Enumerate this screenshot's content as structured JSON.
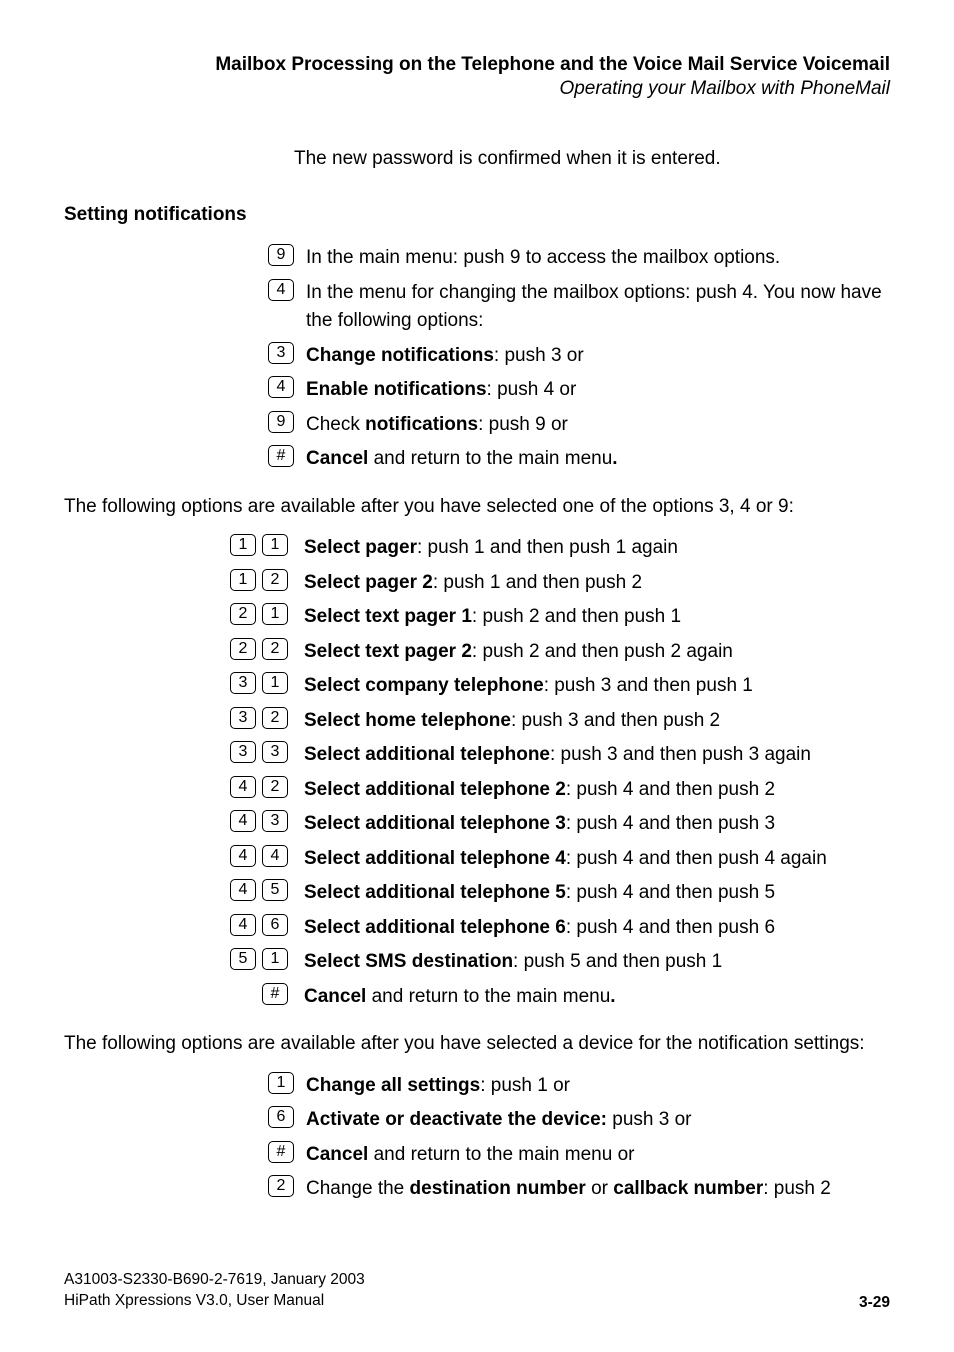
{
  "header": {
    "bold": "Mailbox Processing on the Telephone and the Voice Mail Service Voicemail",
    "italic": "Operating your Mailbox with PhoneMail"
  },
  "intro": "The new password is confirmed when it is entered.",
  "section1": {
    "title": "Setting notifications",
    "rows": [
      {
        "key": "9",
        "text": "In the main menu: push 9 to access the mailbox options."
      },
      {
        "key": "4",
        "text": "In the menu for changing the mailbox options: push 4. You now have the following options:"
      },
      {
        "key": "3",
        "bold": "Change notifications",
        "rest": ": push 3 or"
      },
      {
        "key": "4",
        "bold": "Enable notifications",
        "rest": ": push 4 or"
      },
      {
        "key": "9",
        "pre": "Check ",
        "bold": "notifications",
        "rest": ": push 9 or"
      },
      {
        "key": "#",
        "bold": "Cancel",
        "rest": " and return to the main menu",
        "boldPeriod": "."
      }
    ]
  },
  "para1": "The following options are available after you have selected one of the options 3, 4 or 9:",
  "section2": {
    "rows": [
      {
        "k1": "1",
        "k2": "1",
        "bold": "Select pager",
        "rest": ": push 1 and then push 1 again"
      },
      {
        "k1": "1",
        "k2": "2",
        "bold": "Select pager 2",
        "rest": ": push 1 and then push 2"
      },
      {
        "k1": "2",
        "k2": "1",
        "bold": "Select text pager 1",
        "rest": ": push 2 and then push 1"
      },
      {
        "k1": "2",
        "k2": "2",
        "bold": "Select text pager 2",
        "rest": ": push 2 and then push 2 again"
      },
      {
        "k1": "3",
        "k2": "1",
        "bold": "Select company telephone",
        "rest": ": push 3 and then push 1"
      },
      {
        "k1": "3",
        "k2": "2",
        "bold": "Select home telephone",
        "rest": ": push 3 and then push 2"
      },
      {
        "k1": "3",
        "k2": "3",
        "bold": "Select additional telephone",
        "rest": ": push 3 and then push 3 again"
      },
      {
        "k1": "4",
        "k2": "2",
        "bold": "Select additional telephone 2",
        "rest": ": push 4 and then push 2"
      },
      {
        "k1": "4",
        "k2": "3",
        "bold": "Select additional telephone 3",
        "rest": ": push 4 and then push 3"
      },
      {
        "k1": "4",
        "k2": "4",
        "bold": "Select additional telephone 4",
        "rest": ": push 4 and then push 4 again"
      },
      {
        "k1": "4",
        "k2": "5",
        "bold": "Select additional telephone 5",
        "rest": ": push 4 and then push 5"
      },
      {
        "k1": "4",
        "k2": "6",
        "bold": "Select additional telephone 6",
        "rest": ": push 4 and then push 6"
      },
      {
        "k1": "5",
        "k2": "1",
        "bold": "Select SMS destination",
        "rest": ": push 5 and then push 1"
      },
      {
        "k1": "",
        "k2": "#",
        "bold": "Cancel",
        "rest": " and return to the main menu",
        "boldPeriod": "."
      }
    ]
  },
  "para2": "The following options are available after you have selected a device for the notification settings:",
  "section3": {
    "rows": [
      {
        "key": "1",
        "bold": "Change all settings",
        "rest": ": push 1 or"
      },
      {
        "key": "6",
        "bold": "Activate or deactivate the device:",
        "rest": " push 3 or"
      },
      {
        "key": "#",
        "bold": "Cancel",
        "rest": " and return to the main menu or"
      },
      {
        "key": "2",
        "pre": "Change the ",
        "bold": "destination number",
        "mid": " or ",
        "bold2": "callback number",
        "rest": ": push 2"
      }
    ]
  },
  "footer": {
    "line1": "A31003-S2330-B690-2-7619, January 2003",
    "line2": "HiPath Xpressions V3.0, User Manual",
    "page": "3-29"
  }
}
